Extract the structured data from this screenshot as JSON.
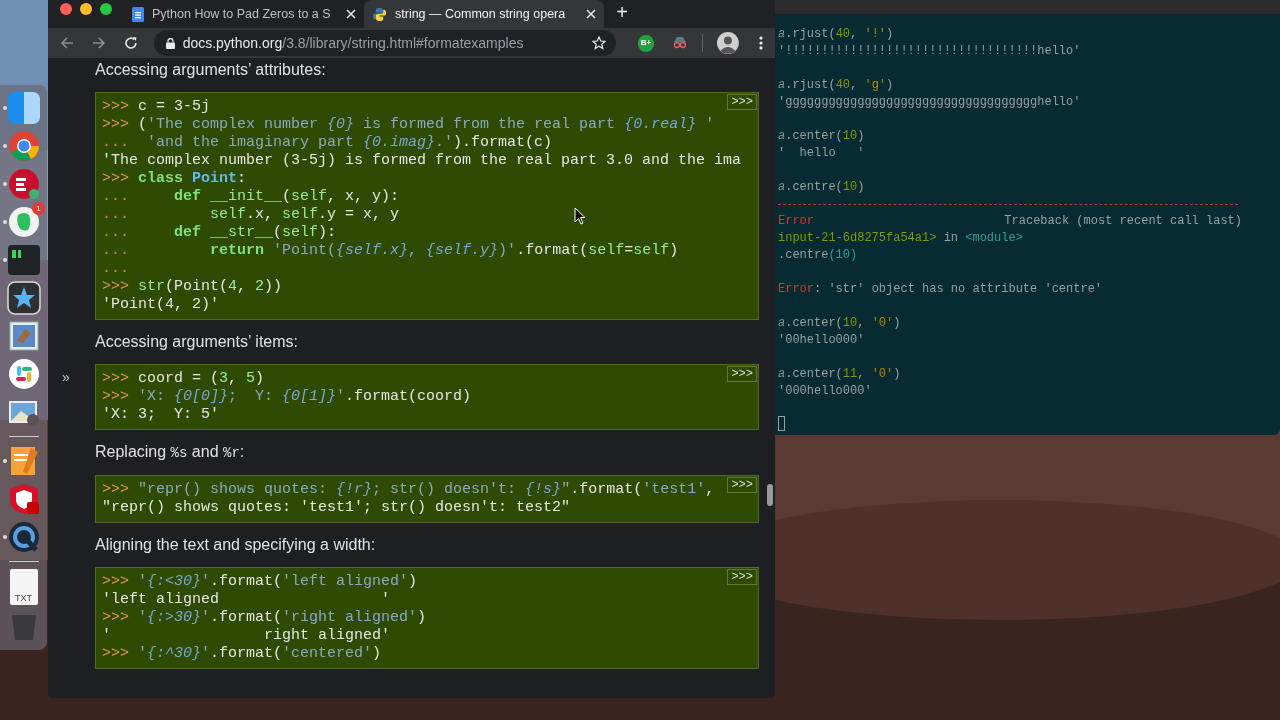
{
  "browser": {
    "tabs": [
      {
        "title": "Python How to Pad Zeros to a S",
        "kind": "doc",
        "selected": false
      },
      {
        "title": "string — Common string opera",
        "kind": "python",
        "selected": true
      }
    ],
    "new_tab": "+",
    "url": {
      "host": "docs.python.org",
      "path": "/3.8/library/string.html#formatexamples"
    },
    "extension_label": "B+",
    "sidebar_toggle": "»",
    "content": [
      {
        "kind": "heading",
        "parts": [
          {
            "kind": "text",
            "text": "Accessing arguments’ attributes:"
          }
        ]
      },
      {
        "kind": "code",
        "toggle": ">>>",
        "lines": [
          [
            {
              "kind": "prompt",
              "text": ">>> "
            },
            {
              "kind": "plain",
              "text": "c = 3-5j"
            }
          ],
          [
            {
              "kind": "prompt",
              "text": ">>> "
            },
            {
              "kind": "plain",
              "text": "("
            },
            {
              "kind": "string",
              "text": "'The complex number "
            },
            {
              "kind": "interp",
              "text": "{0}"
            },
            {
              "kind": "string",
              "text": " is formed from the real part "
            },
            {
              "kind": "interp",
              "text": "{0.real}"
            },
            {
              "kind": "string",
              "text": " '"
            }
          ],
          [
            {
              "kind": "cont",
              "text": "... "
            },
            {
              "kind": "string",
              "text": " 'and the imaginary part "
            },
            {
              "kind": "interp",
              "text": "{0.imag}"
            },
            {
              "kind": "string",
              "text": ".'"
            },
            {
              "kind": "plain",
              "text": ").format(c)"
            }
          ],
          [
            {
              "kind": "plain",
              "text": "'The complex number (3-5j) is formed from the real part 3.0 and the ima"
            }
          ],
          [
            {
              "kind": "prompt",
              "text": ">>> "
            },
            {
              "kind": "keyword",
              "text": "class"
            },
            {
              "kind": "classname",
              "text": " Point"
            },
            {
              "kind": "plain",
              "text": ":"
            }
          ],
          [
            {
              "kind": "cont",
              "text": "...     "
            },
            {
              "kind": "keyword",
              "text": "def"
            },
            {
              "kind": "name",
              "text": " __init__"
            },
            {
              "kind": "plain",
              "text": "("
            },
            {
              "kind": "name",
              "text": "self"
            },
            {
              "kind": "plain",
              "text": ", x, y):"
            }
          ],
          [
            {
              "kind": "cont",
              "text": "...         "
            },
            {
              "kind": "name",
              "text": "self"
            },
            {
              "kind": "plain",
              "text": ".x, "
            },
            {
              "kind": "name",
              "text": "self"
            },
            {
              "kind": "plain",
              "text": ".y = x, y"
            }
          ],
          [
            {
              "kind": "cont",
              "text": "...     "
            },
            {
              "kind": "keyword",
              "text": "def"
            },
            {
              "kind": "name",
              "text": " __str__"
            },
            {
              "kind": "plain",
              "text": "("
            },
            {
              "kind": "name",
              "text": "self"
            },
            {
              "kind": "plain",
              "text": "):"
            }
          ],
          [
            {
              "kind": "cont",
              "text": "...         "
            },
            {
              "kind": "keyword",
              "text": "return"
            },
            {
              "kind": "string",
              "text": " 'Point("
            },
            {
              "kind": "interp",
              "text": "{self.x}"
            },
            {
              "kind": "string",
              "text": ", "
            },
            {
              "kind": "interp",
              "text": "{self.y}"
            },
            {
              "kind": "string",
              "text": ")'"
            },
            {
              "kind": "plain",
              "text": ".format("
            },
            {
              "kind": "name",
              "text": "self"
            },
            {
              "kind": "plain",
              "text": "="
            },
            {
              "kind": "name",
              "text": "self"
            },
            {
              "kind": "plain",
              "text": ")"
            }
          ],
          [
            {
              "kind": "cont",
              "text": "..."
            }
          ],
          [
            {
              "kind": "prompt",
              "text": ">>> "
            },
            {
              "kind": "name",
              "text": "str"
            },
            {
              "kind": "plain",
              "text": "(Point("
            },
            {
              "kind": "number",
              "text": "4"
            },
            {
              "kind": "plain",
              "text": ", "
            },
            {
              "kind": "number",
              "text": "2"
            },
            {
              "kind": "plain",
              "text": "))"
            }
          ],
          [
            {
              "kind": "plain",
              "text": "'Point(4, 2)'"
            }
          ]
        ]
      },
      {
        "kind": "heading",
        "parts": [
          {
            "kind": "text",
            "text": "Accessing arguments’ items:"
          }
        ]
      },
      {
        "kind": "code",
        "toggle": ">>>",
        "lines": [
          [
            {
              "kind": "prompt",
              "text": ">>> "
            },
            {
              "kind": "plain",
              "text": "coord = ("
            },
            {
              "kind": "number",
              "text": "3"
            },
            {
              "kind": "plain",
              "text": ", "
            },
            {
              "kind": "number",
              "text": "5"
            },
            {
              "kind": "plain",
              "text": ")"
            }
          ],
          [
            {
              "kind": "prompt",
              "text": ">>> "
            },
            {
              "kind": "string",
              "text": "'X: "
            },
            {
              "kind": "interp",
              "text": "{0[0]}"
            },
            {
              "kind": "string",
              "text": ";  Y: "
            },
            {
              "kind": "interp",
              "text": "{0[1]}"
            },
            {
              "kind": "string",
              "text": "'"
            },
            {
              "kind": "plain",
              "text": ".format(coord)"
            }
          ],
          [
            {
              "kind": "plain",
              "text": "'X: 3;  Y: 5'"
            }
          ]
        ]
      },
      {
        "kind": "heading",
        "parts": [
          {
            "kind": "text",
            "text": "Replacing "
          },
          {
            "kind": "code",
            "text": "%s"
          },
          {
            "kind": "text",
            "text": " and "
          },
          {
            "kind": "code",
            "text": "%r"
          },
          {
            "kind": "text",
            "text": ":"
          }
        ]
      },
      {
        "kind": "code",
        "toggle": ">>>",
        "lines": [
          [
            {
              "kind": "prompt",
              "text": ">>> "
            },
            {
              "kind": "string",
              "text": "\"repr() shows quotes: "
            },
            {
              "kind": "interp",
              "text": "{!r}"
            },
            {
              "kind": "string",
              "text": "; str() doesn't: "
            },
            {
              "kind": "interp",
              "text": "{!s}"
            },
            {
              "kind": "string",
              "text": "\""
            },
            {
              "kind": "plain",
              "text": ".format("
            },
            {
              "kind": "string",
              "text": "'test1'"
            },
            {
              "kind": "plain",
              "text": ","
            }
          ],
          [
            {
              "kind": "plain",
              "text": "\"repr() shows quotes: 'test1'; str() doesn't: test2\""
            }
          ]
        ]
      },
      {
        "kind": "heading",
        "parts": [
          {
            "kind": "text",
            "text": "Aligning the text and specifying a width:"
          }
        ]
      },
      {
        "kind": "code",
        "toggle": ">>>",
        "lines": [
          [
            {
              "kind": "prompt",
              "text": ">>> "
            },
            {
              "kind": "string",
              "text": "'"
            },
            {
              "kind": "interp",
              "text": "{:<30}"
            },
            {
              "kind": "string",
              "text": "'"
            },
            {
              "kind": "plain",
              "text": ".format("
            },
            {
              "kind": "string",
              "text": "'left aligned'"
            },
            {
              "kind": "plain",
              "text": ")"
            }
          ],
          [
            {
              "kind": "plain",
              "text": "'left aligned                  '"
            }
          ],
          [
            {
              "kind": "prompt",
              "text": ">>> "
            },
            {
              "kind": "string",
              "text": "'"
            },
            {
              "kind": "interp",
              "text": "{:>30}"
            },
            {
              "kind": "string",
              "text": "'"
            },
            {
              "kind": "plain",
              "text": ".format("
            },
            {
              "kind": "string",
              "text": "'right aligned'"
            },
            {
              "kind": "plain",
              "text": ")"
            }
          ],
          [
            {
              "kind": "plain",
              "text": "'                 right aligned'"
            }
          ],
          [
            {
              "kind": "prompt",
              "text": ">>> "
            },
            {
              "kind": "string",
              "text": "'"
            },
            {
              "kind": "interp",
              "text": "{:^30}"
            },
            {
              "kind": "string",
              "text": "'"
            },
            {
              "kind": "plain",
              "text": ".format("
            },
            {
              "kind": "string",
              "text": "'centered'"
            },
            {
              "kind": "plain",
              "text": ")"
            }
          ]
        ]
      }
    ]
  },
  "terminal": {
    "groups": [
      {
        "rule": false,
        "lines": [
          [
            {
              "kind": "var",
              "text": "a"
            },
            {
              "kind": "plain",
              "text": ".rjust("
            },
            {
              "kind": "number",
              "text": "40"
            },
            {
              "kind": "plain",
              "text": ", "
            },
            {
              "kind": "string",
              "text": "'!'"
            },
            {
              "kind": "plain",
              "text": ")"
            }
          ],
          [
            {
              "kind": "plain",
              "text": "'!!!!!!!!!!!!!!!!!!!!!!!!!!!!!!!!!!!hello'"
            }
          ]
        ]
      },
      {
        "rule": false,
        "lines": [
          [
            {
              "kind": "var",
              "text": "a"
            },
            {
              "kind": "plain",
              "text": ".rjust("
            },
            {
              "kind": "number",
              "text": "40"
            },
            {
              "kind": "plain",
              "text": ", "
            },
            {
              "kind": "string",
              "text": "'g'"
            },
            {
              "kind": "plain",
              "text": ")"
            }
          ],
          [
            {
              "kind": "plain",
              "text": "'ggggggggggggggggggggggggggggggggggghello'"
            }
          ]
        ]
      },
      {
        "rule": false,
        "lines": [
          [
            {
              "kind": "var",
              "text": "a"
            },
            {
              "kind": "plain",
              "text": ".center("
            },
            {
              "kind": "number",
              "text": "10"
            },
            {
              "kind": "plain",
              "text": ")"
            }
          ],
          [
            {
              "kind": "plain",
              "text": "'  hello   '"
            }
          ]
        ]
      },
      {
        "rule": false,
        "lines": [
          [
            {
              "kind": "var",
              "text": "a"
            },
            {
              "kind": "plain",
              "text": ".centre("
            },
            {
              "kind": "number",
              "text": "10"
            },
            {
              "kind": "plain",
              "text": ")"
            }
          ]
        ]
      },
      {
        "rule": true,
        "lines": [
          [
            {
              "kind": "error",
              "text": "Error"
            },
            {
              "kind": "right",
              "text": "Traceback (most recent call last)"
            }
          ],
          [
            {
              "kind": "path",
              "text": "input-21-6d8275fa54a1>"
            },
            {
              "kind": "plain",
              "text": " in "
            },
            {
              "kind": "module",
              "text": "<module>"
            }
          ],
          [
            {
              "kind": "plain",
              "text": ".centre"
            },
            {
              "kind": "module",
              "text": "(10)"
            }
          ]
        ]
      },
      {
        "rule": false,
        "lines": [
          [
            {
              "kind": "error",
              "text": "Error"
            },
            {
              "kind": "plain",
              "text": ": 'str' object has no attribute 'centre'"
            }
          ]
        ]
      },
      {
        "rule": false,
        "lines": [
          [
            {
              "kind": "var",
              "text": "a"
            },
            {
              "kind": "plain",
              "text": ".center("
            },
            {
              "kind": "number",
              "text": "10"
            },
            {
              "kind": "plain",
              "text": ", "
            },
            {
              "kind": "string",
              "text": "'0'"
            },
            {
              "kind": "plain",
              "text": ")"
            }
          ],
          [
            {
              "kind": "plain",
              "text": "'00hello000'"
            }
          ]
        ]
      },
      {
        "rule": false,
        "lines": [
          [
            {
              "kind": "var",
              "text": "a"
            },
            {
              "kind": "plain",
              "text": ".center("
            },
            {
              "kind": "number",
              "text": "11"
            },
            {
              "kind": "plain",
              "text": ", "
            },
            {
              "kind": "string",
              "text": "'0'"
            },
            {
              "kind": "plain",
              "text": ")"
            }
          ],
          [
            {
              "kind": "plain",
              "text": "'000hello000'"
            }
          ]
        ]
      }
    ]
  },
  "dock": [
    {
      "kind": "finder",
      "running": true
    },
    {
      "kind": "chrome",
      "running": true
    },
    {
      "kind": "vpn",
      "running": true
    },
    {
      "kind": "notes",
      "running": true,
      "badge": "1"
    },
    {
      "kind": "terminal",
      "running": true
    },
    {
      "kind": "star",
      "running": false
    },
    {
      "kind": "mail",
      "running": false
    },
    {
      "kind": "chat",
      "running": false
    },
    {
      "kind": "preview",
      "running": false
    },
    {
      "kind": "separator"
    },
    {
      "kind": "pages",
      "running": true
    },
    {
      "kind": "shield",
      "running": false
    },
    {
      "kind": "player",
      "running": true
    },
    {
      "kind": "separator"
    },
    {
      "kind": "file",
      "label": "TXT"
    },
    {
      "kind": "trash"
    }
  ]
}
